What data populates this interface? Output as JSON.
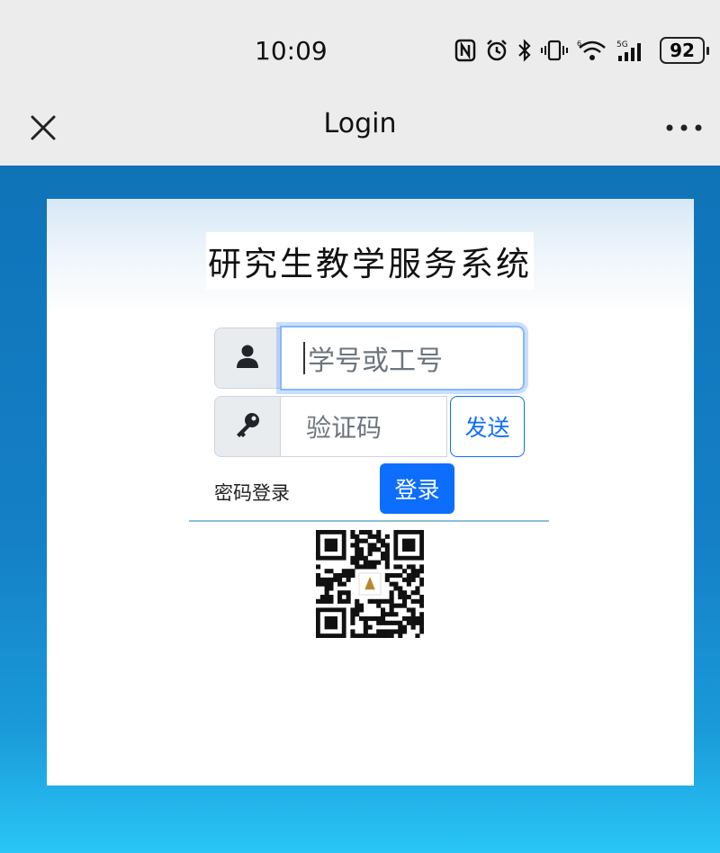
{
  "status": {
    "time": "10:09",
    "icons": [
      "nfc-icon",
      "alarm-icon",
      "bluetooth-icon",
      "vibrate-icon",
      "wifi-icon",
      "5g-signal-icon"
    ],
    "battery": "92"
  },
  "nav": {
    "title": "Login",
    "close_icon": "close-icon",
    "more_icon": "more-icon"
  },
  "login": {
    "system_title": "研究生教学服务系统",
    "user_placeholder": "学号或工号",
    "code_placeholder": "验证码",
    "send_label": "发送",
    "password_login_label": "密码登录",
    "login_label": "登录"
  },
  "colors": {
    "primary": "#0d6efd",
    "page_bg_top": "#0f73b8",
    "page_bg_bottom": "#29c6f7"
  }
}
